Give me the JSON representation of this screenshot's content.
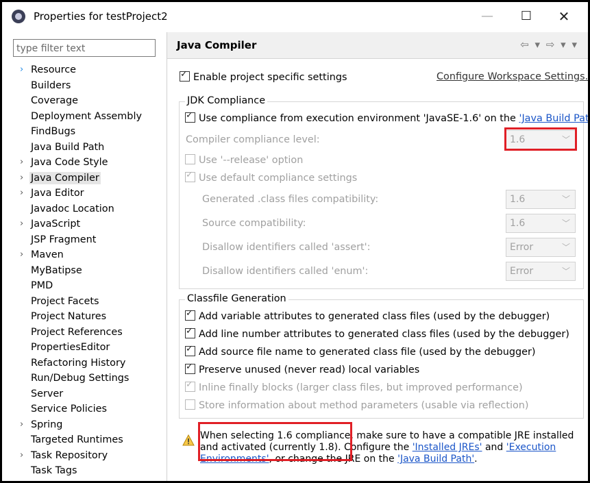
{
  "window": {
    "title": "Properties for testProject2",
    "minimize_glyph": "—",
    "maximize_glyph": "☐",
    "close_glyph": "✕"
  },
  "filter": {
    "placeholder": "type filter text"
  },
  "tree": [
    {
      "label": "Resource",
      "arrow": "blue"
    },
    {
      "label": "Builders",
      "arrow": ""
    },
    {
      "label": "Coverage",
      "arrow": ""
    },
    {
      "label": "Deployment Assembly",
      "arrow": ""
    },
    {
      "label": "FindBugs",
      "arrow": ""
    },
    {
      "label": "Java Build Path",
      "arrow": ""
    },
    {
      "label": "Java Code Style",
      "arrow": "gray"
    },
    {
      "label": "Java Compiler",
      "arrow": "gray",
      "selected": true
    },
    {
      "label": "Java Editor",
      "arrow": "gray"
    },
    {
      "label": "Javadoc Location",
      "arrow": ""
    },
    {
      "label": "JavaScript",
      "arrow": "gray"
    },
    {
      "label": "JSP Fragment",
      "arrow": ""
    },
    {
      "label": "Maven",
      "arrow": "gray"
    },
    {
      "label": "MyBatipse",
      "arrow": ""
    },
    {
      "label": "PMD",
      "arrow": ""
    },
    {
      "label": "Project Facets",
      "arrow": ""
    },
    {
      "label": "Project Natures",
      "arrow": ""
    },
    {
      "label": "Project References",
      "arrow": ""
    },
    {
      "label": "PropertiesEditor",
      "arrow": ""
    },
    {
      "label": "Refactoring History",
      "arrow": ""
    },
    {
      "label": "Run/Debug Settings",
      "arrow": ""
    },
    {
      "label": "Server",
      "arrow": ""
    },
    {
      "label": "Service Policies",
      "arrow": ""
    },
    {
      "label": "Spring",
      "arrow": "gray"
    },
    {
      "label": "Targeted Runtimes",
      "arrow": ""
    },
    {
      "label": "Task Repository",
      "arrow": "gray"
    },
    {
      "label": "Task Tags",
      "arrow": ""
    }
  ],
  "page": {
    "title": "Java Compiler",
    "nav_icons": "⇦ ▾ ⇨ ▾ ▾",
    "enable_specific": "Enable project specific settings",
    "configure_workspace": "Configure Workspace Settings...",
    "jdk": {
      "group_title": "JDK Compliance",
      "use_ee_prefix": "Use compliance from execution environment 'JavaSE-1.6' on the ",
      "use_ee_link": "'Java Build Path'",
      "compliance_label": "Compiler compliance level:",
      "compliance_value": "1.6",
      "release_option": "Use '--release' option",
      "default_settings": "Use default compliance settings",
      "generated_label": "Generated .class files compatibility:",
      "generated_value": "1.6",
      "source_label": "Source compatibility:",
      "source_value": "1.6",
      "assert_label": "Disallow identifiers called 'assert':",
      "assert_value": "Error",
      "enum_label": "Disallow identifiers called 'enum':",
      "enum_value": "Error"
    },
    "classfile": {
      "group_title": "Classfile Generation",
      "opt_variable": "Add variable attributes to generated class files (used by the debugger)",
      "opt_line": "Add line number attributes to generated class files (used by the debugger)",
      "opt_source": "Add source file name to generated class file (used by the debugger)",
      "opt_preserve": "Preserve unused (never read) local variables",
      "opt_inline": "Inline finally blocks (larger class files, but improved performance)",
      "opt_store": "Store information about method parameters (usable via reflection)"
    },
    "warning": {
      "line1": "When selecting 1.6 compliance, make sure to have a compatible JRE installed",
      "line2_a": "and activated (currently 1.8). Configure the ",
      "link_jres": "'Installed JREs'",
      "line2_b": " and ",
      "link_ee": "'Execution Environments'",
      "line3_a": ", or change the JRE on the ",
      "link_buildpath": "'Java Build Path'",
      "line3_b": "."
    }
  },
  "colors": {
    "highlight": "#e01f26",
    "link": "#1a55c8",
    "selection": "#e5e5e5"
  }
}
